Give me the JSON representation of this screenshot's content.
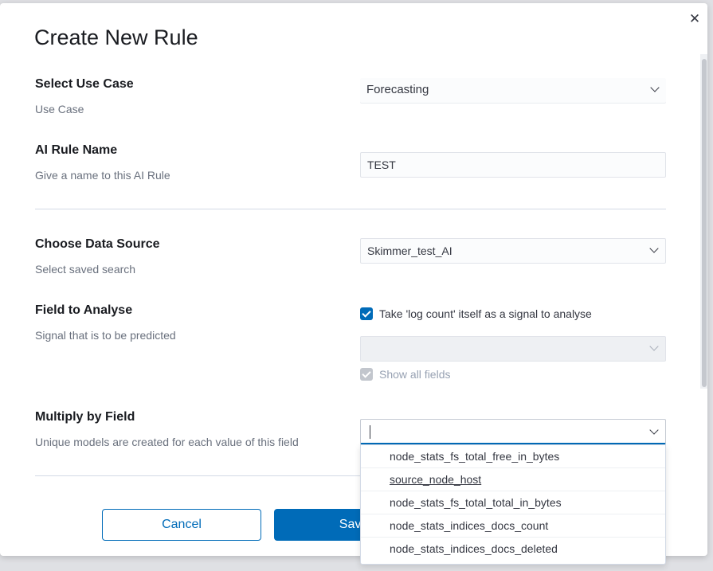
{
  "modal": {
    "title": "Create New Rule",
    "close_icon": "close-icon"
  },
  "use_case": {
    "label": "Select Use Case",
    "description": "Use Case",
    "value": "Forecasting"
  },
  "rule_name": {
    "label": "AI Rule Name",
    "description": "Give a name to this AI Rule",
    "value": "TEST"
  },
  "data_source": {
    "label": "Choose Data Source",
    "description": "Select saved search",
    "value": "Skimmer_test_AI"
  },
  "field_to_analyse": {
    "label": "Field to Analyse",
    "description": "Signal that is to be predicted",
    "log_count_checkbox": "Take 'log count' itself as a signal to analyse",
    "show_all_fields": "Show all fields"
  },
  "multiply_by": {
    "label": "Multiply by Field",
    "description": "Unique models are created for each value of this field",
    "options": [
      "node_stats_fs_total_free_in_bytes",
      "source_node_host",
      "node_stats_fs_total_total_in_bytes",
      "node_stats_indices_docs_count",
      "node_stats_indices_docs_deleted"
    ]
  },
  "buttons": {
    "cancel": "Cancel",
    "save": "Save"
  },
  "colors": {
    "primary": "#006bb8",
    "text": "#1a1c21",
    "muted": "#69707d"
  }
}
